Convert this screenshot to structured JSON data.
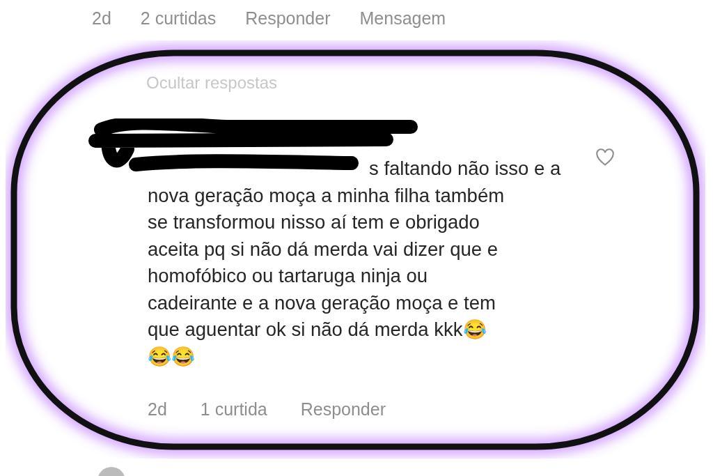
{
  "parent_actions": {
    "time": "2d",
    "likes": "2 curtidas",
    "reply": "Responder",
    "message": "Mensagem"
  },
  "toggle_replies": "Ocultar respostas",
  "reply": {
    "text_lines": [
      "s faltando não isso e a",
      "nova geração moça a minha filha também",
      "se transformou nisso aí tem  e obrigado",
      "aceita pq si não dá merda vai dizer que e",
      "homofóbico ou tartaruga ninja ou",
      "cadeirante e a nova geração moça e tem",
      "que aguentar ok si não dá merda kkk😂",
      "😂😂"
    ],
    "liked": false,
    "time": "2d",
    "likes": "1 curtida",
    "reply_action": "Responder"
  }
}
